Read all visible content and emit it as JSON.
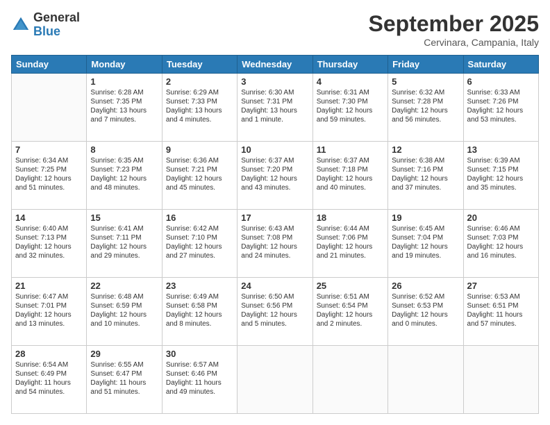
{
  "logo": {
    "general": "General",
    "blue": "Blue"
  },
  "header": {
    "month": "September 2025",
    "location": "Cervinara, Campania, Italy"
  },
  "weekdays": [
    "Sunday",
    "Monday",
    "Tuesday",
    "Wednesday",
    "Thursday",
    "Friday",
    "Saturday"
  ],
  "weeks": [
    [
      {
        "day": "",
        "lines": []
      },
      {
        "day": "1",
        "lines": [
          "Sunrise: 6:28 AM",
          "Sunset: 7:35 PM",
          "Daylight: 13 hours",
          "and 7 minutes."
        ]
      },
      {
        "day": "2",
        "lines": [
          "Sunrise: 6:29 AM",
          "Sunset: 7:33 PM",
          "Daylight: 13 hours",
          "and 4 minutes."
        ]
      },
      {
        "day": "3",
        "lines": [
          "Sunrise: 6:30 AM",
          "Sunset: 7:31 PM",
          "Daylight: 13 hours",
          "and 1 minute."
        ]
      },
      {
        "day": "4",
        "lines": [
          "Sunrise: 6:31 AM",
          "Sunset: 7:30 PM",
          "Daylight: 12 hours",
          "and 59 minutes."
        ]
      },
      {
        "day": "5",
        "lines": [
          "Sunrise: 6:32 AM",
          "Sunset: 7:28 PM",
          "Daylight: 12 hours",
          "and 56 minutes."
        ]
      },
      {
        "day": "6",
        "lines": [
          "Sunrise: 6:33 AM",
          "Sunset: 7:26 PM",
          "Daylight: 12 hours",
          "and 53 minutes."
        ]
      }
    ],
    [
      {
        "day": "7",
        "lines": [
          "Sunrise: 6:34 AM",
          "Sunset: 7:25 PM",
          "Daylight: 12 hours",
          "and 51 minutes."
        ]
      },
      {
        "day": "8",
        "lines": [
          "Sunrise: 6:35 AM",
          "Sunset: 7:23 PM",
          "Daylight: 12 hours",
          "and 48 minutes."
        ]
      },
      {
        "day": "9",
        "lines": [
          "Sunrise: 6:36 AM",
          "Sunset: 7:21 PM",
          "Daylight: 12 hours",
          "and 45 minutes."
        ]
      },
      {
        "day": "10",
        "lines": [
          "Sunrise: 6:37 AM",
          "Sunset: 7:20 PM",
          "Daylight: 12 hours",
          "and 43 minutes."
        ]
      },
      {
        "day": "11",
        "lines": [
          "Sunrise: 6:37 AM",
          "Sunset: 7:18 PM",
          "Daylight: 12 hours",
          "and 40 minutes."
        ]
      },
      {
        "day": "12",
        "lines": [
          "Sunrise: 6:38 AM",
          "Sunset: 7:16 PM",
          "Daylight: 12 hours",
          "and 37 minutes."
        ]
      },
      {
        "day": "13",
        "lines": [
          "Sunrise: 6:39 AM",
          "Sunset: 7:15 PM",
          "Daylight: 12 hours",
          "and 35 minutes."
        ]
      }
    ],
    [
      {
        "day": "14",
        "lines": [
          "Sunrise: 6:40 AM",
          "Sunset: 7:13 PM",
          "Daylight: 12 hours",
          "and 32 minutes."
        ]
      },
      {
        "day": "15",
        "lines": [
          "Sunrise: 6:41 AM",
          "Sunset: 7:11 PM",
          "Daylight: 12 hours",
          "and 29 minutes."
        ]
      },
      {
        "day": "16",
        "lines": [
          "Sunrise: 6:42 AM",
          "Sunset: 7:10 PM",
          "Daylight: 12 hours",
          "and 27 minutes."
        ]
      },
      {
        "day": "17",
        "lines": [
          "Sunrise: 6:43 AM",
          "Sunset: 7:08 PM",
          "Daylight: 12 hours",
          "and 24 minutes."
        ]
      },
      {
        "day": "18",
        "lines": [
          "Sunrise: 6:44 AM",
          "Sunset: 7:06 PM",
          "Daylight: 12 hours",
          "and 21 minutes."
        ]
      },
      {
        "day": "19",
        "lines": [
          "Sunrise: 6:45 AM",
          "Sunset: 7:04 PM",
          "Daylight: 12 hours",
          "and 19 minutes."
        ]
      },
      {
        "day": "20",
        "lines": [
          "Sunrise: 6:46 AM",
          "Sunset: 7:03 PM",
          "Daylight: 12 hours",
          "and 16 minutes."
        ]
      }
    ],
    [
      {
        "day": "21",
        "lines": [
          "Sunrise: 6:47 AM",
          "Sunset: 7:01 PM",
          "Daylight: 12 hours",
          "and 13 minutes."
        ]
      },
      {
        "day": "22",
        "lines": [
          "Sunrise: 6:48 AM",
          "Sunset: 6:59 PM",
          "Daylight: 12 hours",
          "and 10 minutes."
        ]
      },
      {
        "day": "23",
        "lines": [
          "Sunrise: 6:49 AM",
          "Sunset: 6:58 PM",
          "Daylight: 12 hours",
          "and 8 minutes."
        ]
      },
      {
        "day": "24",
        "lines": [
          "Sunrise: 6:50 AM",
          "Sunset: 6:56 PM",
          "Daylight: 12 hours",
          "and 5 minutes."
        ]
      },
      {
        "day": "25",
        "lines": [
          "Sunrise: 6:51 AM",
          "Sunset: 6:54 PM",
          "Daylight: 12 hours",
          "and 2 minutes."
        ]
      },
      {
        "day": "26",
        "lines": [
          "Sunrise: 6:52 AM",
          "Sunset: 6:53 PM",
          "Daylight: 12 hours",
          "and 0 minutes."
        ]
      },
      {
        "day": "27",
        "lines": [
          "Sunrise: 6:53 AM",
          "Sunset: 6:51 PM",
          "Daylight: 11 hours",
          "and 57 minutes."
        ]
      }
    ],
    [
      {
        "day": "28",
        "lines": [
          "Sunrise: 6:54 AM",
          "Sunset: 6:49 PM",
          "Daylight: 11 hours",
          "and 54 minutes."
        ]
      },
      {
        "day": "29",
        "lines": [
          "Sunrise: 6:55 AM",
          "Sunset: 6:47 PM",
          "Daylight: 11 hours",
          "and 51 minutes."
        ]
      },
      {
        "day": "30",
        "lines": [
          "Sunrise: 6:57 AM",
          "Sunset: 6:46 PM",
          "Daylight: 11 hours",
          "and 49 minutes."
        ]
      },
      {
        "day": "",
        "lines": []
      },
      {
        "day": "",
        "lines": []
      },
      {
        "day": "",
        "lines": []
      },
      {
        "day": "",
        "lines": []
      }
    ]
  ]
}
